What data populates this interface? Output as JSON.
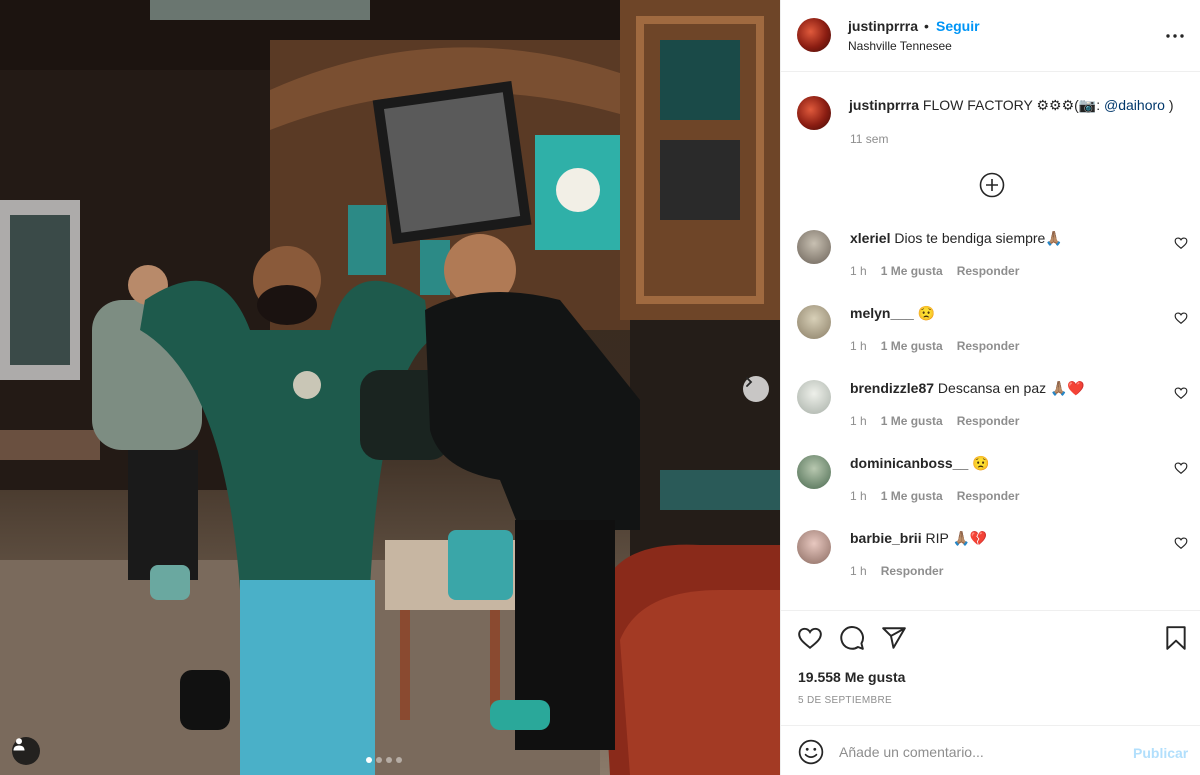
{
  "post": {
    "username": "justinprrra",
    "follow_separator": "•",
    "follow_label": "Seguir",
    "location": "Nashville Tennesee",
    "more_icon": "more-horizontal-icon"
  },
  "caption": {
    "username": "justinprrra",
    "text": " FLOW FACTORY ⚙⚙⚙(📷: ",
    "mention": "@daihoro",
    "text_end": " )",
    "time": "11 sem",
    "load_more_icon": "plus-circle-icon"
  },
  "comments": [
    {
      "username": "xleriel",
      "text": " Dios te bendiga siempre🙏🏽",
      "time": "1 h",
      "likes": "1 Me gusta",
      "reply": "Responder"
    },
    {
      "username": "melyn___",
      "text": " 😟",
      "time": "1 h",
      "likes": "1 Me gusta",
      "reply": "Responder"
    },
    {
      "username": "brendizzle87",
      "text": " Descansa en paz 🙏🏽❤️",
      "time": "1 h",
      "likes": "1 Me gusta",
      "reply": "Responder"
    },
    {
      "username": "dominicanboss__",
      "text": " 😟",
      "time": "1 h",
      "likes": "1 Me gusta",
      "reply": "Responder"
    },
    {
      "username": "barbie_brii",
      "text": " RIP 🙏🏽💔",
      "time": "1 h",
      "likes": "",
      "reply": "Responder"
    }
  ],
  "actions": {
    "like_icon": "heart-icon",
    "comment_icon": "comment-icon",
    "share_icon": "send-icon",
    "save_icon": "bookmark-icon",
    "likes_count": "19.558 Me gusta",
    "date": "5 DE SEPTIEMBRE"
  },
  "add_comment": {
    "emoji_icon": "emoji-icon",
    "placeholder": "Añade un comentario...",
    "publish_label": "Publicar"
  },
  "carousel": {
    "slide_count": 4,
    "active_index": 1
  },
  "colors": {
    "accent": "#0095f6",
    "text": "#262626",
    "muted": "#8e8e8e",
    "publish_disabled": "#b2dffc",
    "border": "#efefef"
  }
}
